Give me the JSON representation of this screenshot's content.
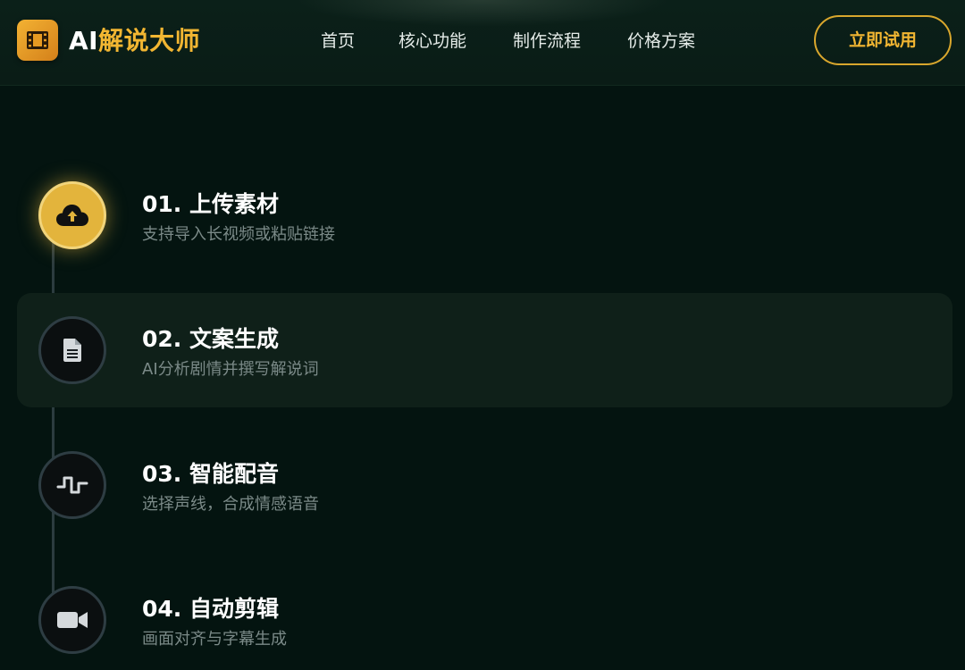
{
  "header": {
    "brand_prefix": "AI",
    "brand_suffix": "解说大师",
    "logo_icon": "film-icon",
    "nav": [
      {
        "label": "首页"
      },
      {
        "label": "核心功能"
      },
      {
        "label": "制作流程"
      },
      {
        "label": "价格方案"
      }
    ],
    "cta_label": "立即试用"
  },
  "colors": {
    "accent": "#f2b632",
    "background": "#041410",
    "header": "#0a1c16",
    "highlight_card": "#0f2019",
    "muted_text": "#7b8a88"
  },
  "steps": [
    {
      "title": "01. 上传素材",
      "desc": "支持导入长视频或粘贴链接",
      "icon": "cloud-upload-icon",
      "state": "active"
    },
    {
      "title": "02. 文案生成",
      "desc": "AI分析剧情并撰写解说词",
      "icon": "document-icon",
      "state": "default"
    },
    {
      "title": "03. 智能配音",
      "desc": "选择声线，合成情感语音",
      "icon": "waveform-icon",
      "state": "default"
    },
    {
      "title": "04. 自动剪辑",
      "desc": "画面对齐与字幕生成",
      "icon": "video-camera-icon",
      "state": "default"
    }
  ]
}
